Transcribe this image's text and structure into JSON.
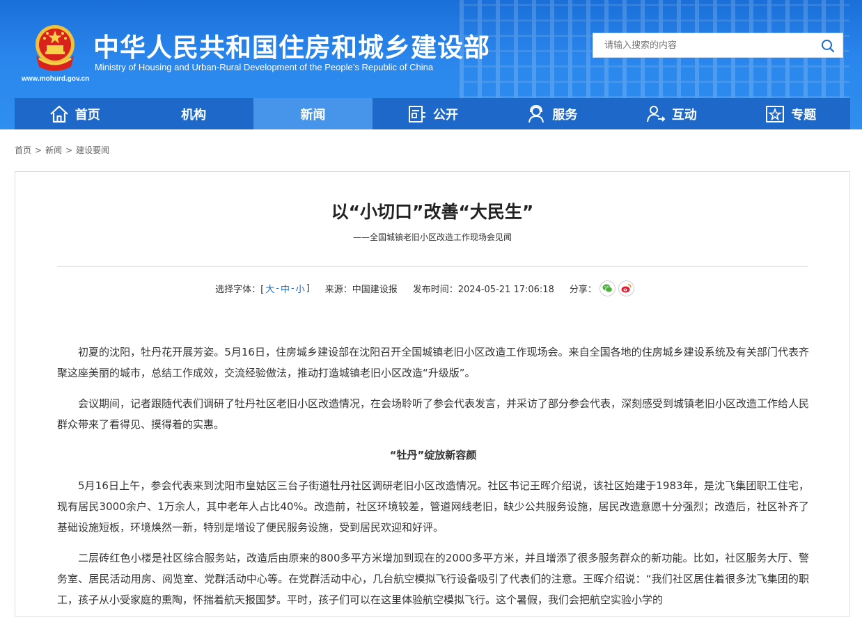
{
  "header": {
    "site_title": "中华人民共和国住房和城乡建设部",
    "site_en": "Ministry of Housing and Urban-Rural Development of the People’s Republic of China",
    "site_url": "www.mohurd.gov.cn",
    "search_placeholder": "请输入搜索的内容"
  },
  "nav": [
    {
      "label": "首页",
      "icon": "home-icon"
    },
    {
      "label": "机构",
      "icon": ""
    },
    {
      "label": "新闻",
      "icon": "",
      "active": true
    },
    {
      "label": "公开",
      "icon": "document-icon"
    },
    {
      "label": "服务",
      "icon": "service-icon"
    },
    {
      "label": "互动",
      "icon": "user-interact-icon"
    },
    {
      "label": "专题",
      "icon": "star-box-icon"
    }
  ],
  "breadcrumb": [
    "首页",
    "新闻",
    "建设要闻"
  ],
  "breadcrumb_sep": ">",
  "article": {
    "title": "以“小切口”改善“大民生”",
    "subtitle": "——全国城镇老旧小区改造工作现场会见闻",
    "font_label": "选择字体：[",
    "font_sizes": [
      "大",
      "中",
      "小"
    ],
    "font_close": "]",
    "source": "来源：中国建设报",
    "publish": "发布时间：2024-05-21 17:06:18",
    "share_label": "分享：",
    "paragraphs": [
      "初夏的沈阳，牡丹花开展芳姿。5月16日，住房城乡建设部在沈阳召开全国城镇老旧小区改造工作现场会。来自全国各地的住房城乡建设系统及有关部门代表齐聚这座美丽的城市，总结工作成效，交流经验做法，推动打造城镇老旧小区改造“升级版”。",
      "会议期间，记者跟随代表们调研了牡丹社区老旧小区改造情况，在会场聆听了参会代表发言，并采访了部分参会代表，深刻感受到城镇老旧小区改造工作给人民群众带来了看得见、摸得着的实惠。",
      "“牡丹”绽放新容颜",
      "5月16日上午，参会代表来到沈阳市皇姑区三台子街道牡丹社区调研老旧小区改造情况。社区书记王晖介绍说，该社区始建于1983年，是沈飞集团职工住宅，现有居民3000余户、1万余人，其中老年人占比40%。改造前，社区环境较差，管道网线老旧，缺少公共服务设施，居民改造意愿十分强烈；改造后，社区补齐了基础设施短板，环境焕然一新，特别是增设了便民服务设施，受到居民欢迎和好评。",
      "二层砖红色小楼是社区综合服务站，改造后由原来的800多平方米增加到现在的2000多平方米，并且增添了很多服务群众的新功能。比如，社区服务大厅、警务室、居民活动用房、阅览室、党群活动中心等。在党群活动中心，几台航空模拟飞行设备吸引了代表们的注意。王晖介绍说：“我们社区居住着很多沈飞集团的职工，孩子从小受家庭的熏陶，怀揣着航天报国梦。平时，孩子们可以在这里体验航空模拟飞行。这个暑假，我们会把航空实验小学的"
    ]
  }
}
